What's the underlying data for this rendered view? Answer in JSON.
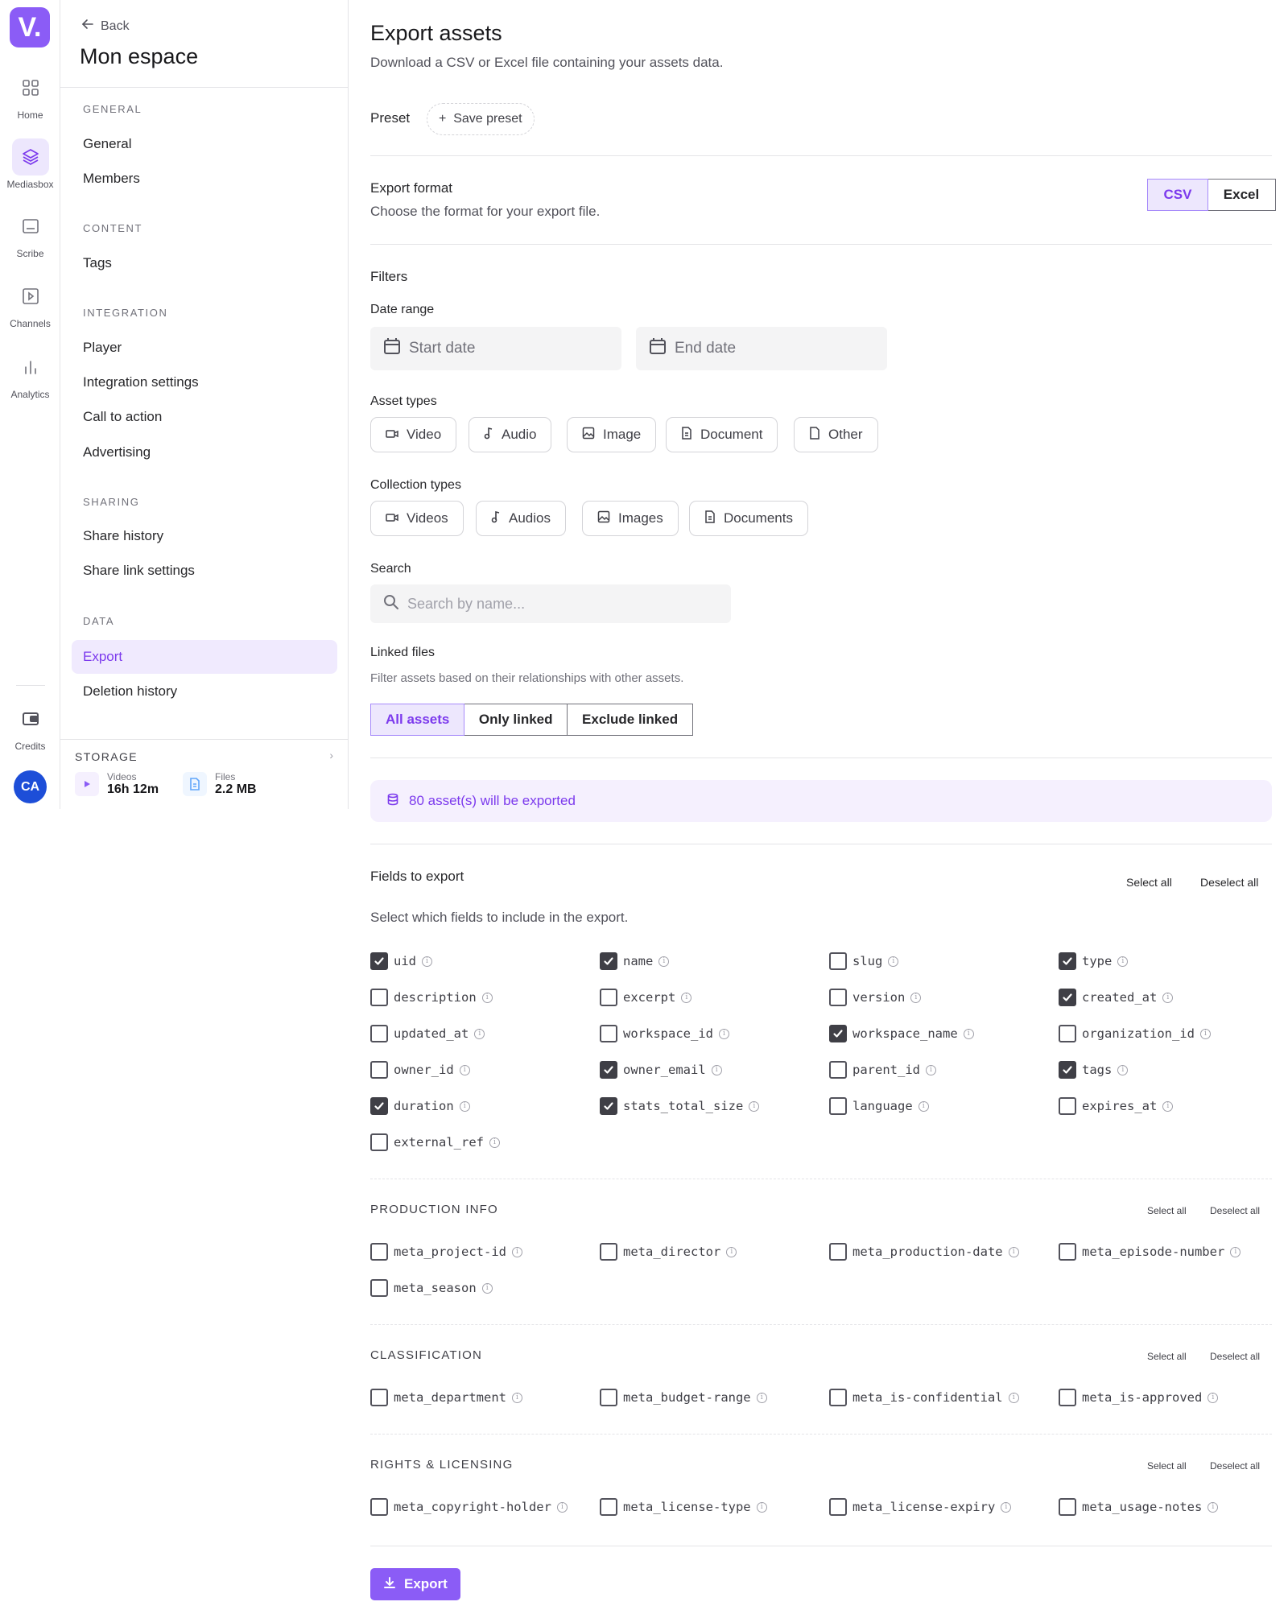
{
  "rail": {
    "logo": "V.",
    "items": [
      {
        "label": "Home",
        "icon": "grid-icon"
      },
      {
        "label": "Mediasbox",
        "icon": "layers-icon"
      },
      {
        "label": "Scribe",
        "icon": "caption-icon"
      },
      {
        "label": "Channels",
        "icon": "play-square-icon"
      },
      {
        "label": "Analytics",
        "icon": "bar-chart-icon"
      }
    ],
    "credits_label": "Credits",
    "avatar": "CA"
  },
  "sidebar": {
    "back": "Back",
    "title": "Mon espace",
    "sections": {
      "general": "GENERAL",
      "content": "CONTENT",
      "integration": "INTEGRATION",
      "sharing": "SHARING",
      "data": "DATA"
    },
    "items": {
      "general": "General",
      "members": "Members",
      "tags": "Tags",
      "player": "Player",
      "integration_settings": "Integration settings",
      "call_to_action": "Call to action",
      "advertising": "Advertising",
      "share_history": "Share history",
      "share_link_settings": "Share link settings",
      "export": "Export",
      "deletion_history": "Deletion history"
    },
    "storage": {
      "label": "STORAGE",
      "videos_caption": "Videos",
      "videos_value": "16h 12m",
      "files_caption": "Files",
      "files_value": "2.2 MB"
    }
  },
  "main": {
    "title": "Export assets",
    "subtitle": "Download a CSV or Excel file containing your assets data.",
    "preset_label": "Preset",
    "save_preset": "Save preset",
    "format": {
      "label": "Export format",
      "desc": "Choose the format for your export file.",
      "options": [
        "CSV",
        "Excel"
      ],
      "selected": "CSV"
    },
    "filters": {
      "title": "Filters",
      "date_range": "Date range",
      "start_placeholder": "Start date",
      "end_placeholder": "End date",
      "asset_types_label": "Asset types",
      "asset_types": [
        "Video",
        "Audio",
        "Image",
        "Document",
        "Other"
      ],
      "collection_types_label": "Collection types",
      "collection_types": [
        "Videos",
        "Audios",
        "Images",
        "Documents"
      ],
      "search_label": "Search",
      "search_placeholder": "Search by name...",
      "linked_label": "Linked files",
      "linked_desc": "Filter assets based on their relationships with other assets.",
      "linked_options": [
        "All assets",
        "Only linked",
        "Exclude linked"
      ],
      "linked_selected": "All assets"
    },
    "banner": "80 asset(s) will be exported",
    "fields": {
      "title": "Fields to export",
      "desc": "Select which fields to include in the export.",
      "select_all": "Select all",
      "deselect_all": "Deselect all",
      "list": [
        {
          "name": "uid",
          "checked": true
        },
        {
          "name": "name",
          "checked": true
        },
        {
          "name": "slug",
          "checked": false
        },
        {
          "name": "type",
          "checked": true
        },
        {
          "name": "description",
          "checked": false
        },
        {
          "name": "excerpt",
          "checked": false
        },
        {
          "name": "version",
          "checked": false
        },
        {
          "name": "created_at",
          "checked": true
        },
        {
          "name": "updated_at",
          "checked": false
        },
        {
          "name": "workspace_id",
          "checked": false
        },
        {
          "name": "workspace_name",
          "checked": true
        },
        {
          "name": "organization_id",
          "checked": false
        },
        {
          "name": "owner_id",
          "checked": false
        },
        {
          "name": "owner_email",
          "checked": true
        },
        {
          "name": "parent_id",
          "checked": false
        },
        {
          "name": "tags",
          "checked": true
        },
        {
          "name": "duration",
          "checked": true
        },
        {
          "name": "stats_total_size",
          "checked": true
        },
        {
          "name": "language",
          "checked": false
        },
        {
          "name": "expires_at",
          "checked": false
        },
        {
          "name": "external_ref",
          "checked": false
        }
      ]
    },
    "meta_sections": [
      {
        "title": "PRODUCTION INFO",
        "select_all": "Select all",
        "deselect_all": "Deselect all",
        "fields": [
          "meta_project-id",
          "meta_director",
          "meta_production-date",
          "meta_episode-number",
          "meta_season"
        ]
      },
      {
        "title": "CLASSIFICATION",
        "select_all": "Select all",
        "deselect_all": "Deselect all",
        "fields": [
          "meta_department",
          "meta_budget-range",
          "meta_is-confidential",
          "meta_is-approved"
        ]
      },
      {
        "title": "RIGHTS & LICENSING",
        "select_all": "Select all",
        "deselect_all": "Deselect all",
        "fields": [
          "meta_copyright-holder",
          "meta_license-type",
          "meta_license-expiry",
          "meta_usage-notes"
        ]
      }
    ],
    "export_button": "Export",
    "colors": {
      "accent": "#8b5cf6",
      "accent_text": "#7c3aed",
      "accent_bg": "#f0eafe"
    }
  }
}
